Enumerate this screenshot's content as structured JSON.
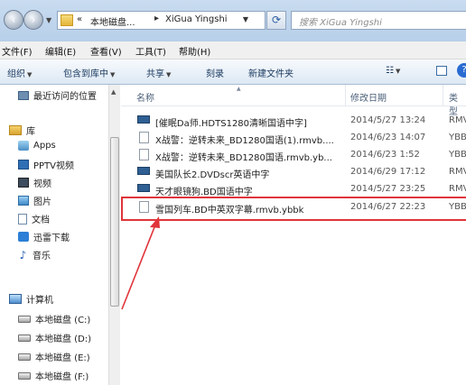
{
  "address": {
    "prefix": "«",
    "part1": "本地磁盘...",
    "separator": "▸",
    "part2": "XiGua Yingshi"
  },
  "search": {
    "placeholder": "搜索 XiGua Yingshi"
  },
  "menu": [
    "文件(F)",
    "编辑(E)",
    "查看(V)",
    "工具(T)",
    "帮助(H)"
  ],
  "toolbar": {
    "organize": "组织",
    "include_library": "包含到库中",
    "share": "共享",
    "burn": "刻录",
    "new_folder": "新建文件夹"
  },
  "nav": {
    "recent": "最近访问的位置",
    "libraries": "库",
    "apps": "Apps",
    "pptv": "PPTV视频",
    "video": "视频",
    "pictures": "图片",
    "documents": "文档",
    "thunder": "迅雷下载",
    "music": "音乐",
    "computer": "计算机",
    "drive_c": "本地磁盘 (C:)",
    "drive_d": "本地磁盘 (D:)",
    "drive_e": "本地磁盘 (E:)",
    "drive_f": "本地磁盘 (F:)"
  },
  "columns": {
    "name": "名称",
    "date": "修改日期",
    "type": "类型"
  },
  "files": [
    {
      "name": "[催眠Da师.HDTS1280清晰国语中字]",
      "date": "2014/5/27 13:24",
      "type": "RMV",
      "icon": "rmvb-icon"
    },
    {
      "name": "X战警：逆转未来_BD1280国语(1).rmvb....",
      "date": "2014/6/23 14:07",
      "type": "YBB",
      "icon": "file-icon"
    },
    {
      "name": "X战警：逆转未来_BD1280国语.rmvb.yb...",
      "date": "2014/6/23 1:52",
      "type": "YBB",
      "icon": "file-icon"
    },
    {
      "name": "美国队长2.DVDscr英语中字",
      "date": "2014/6/29 17:12",
      "type": "RMV",
      "icon": "rmvb-icon"
    },
    {
      "name": "天才眼镜狗.BD国语中字",
      "date": "2014/5/27 23:25",
      "type": "RMV",
      "icon": "rmvb-icon"
    },
    {
      "name": "雪国列车.BD中英双字幕.rmvb.ybbk",
      "date": "2014/6/27 22:23",
      "type": "YBB",
      "icon": "file-icon"
    }
  ],
  "colors": {
    "highlight": "#e0343a",
    "toolbar_text": "#1a3a60"
  }
}
